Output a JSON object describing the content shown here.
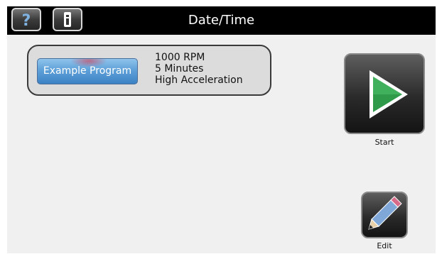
{
  "header": {
    "title": "Date/Time",
    "help_icon": "question-mark-icon",
    "info_icon": "info-icon"
  },
  "program": {
    "name": "Example Program",
    "speed": "1000 RPM",
    "duration": "5 Minutes",
    "acceleration": "High Acceleration"
  },
  "actions": {
    "start_label": "Start",
    "start_icon": "play-icon",
    "edit_label": "Edit",
    "edit_icon": "pencil-icon"
  },
  "colors": {
    "header_bg": "#000000",
    "screen_bg": "#f0f0f0",
    "program_button": "#5ea0d8",
    "play_green": "#2e9a4a"
  }
}
